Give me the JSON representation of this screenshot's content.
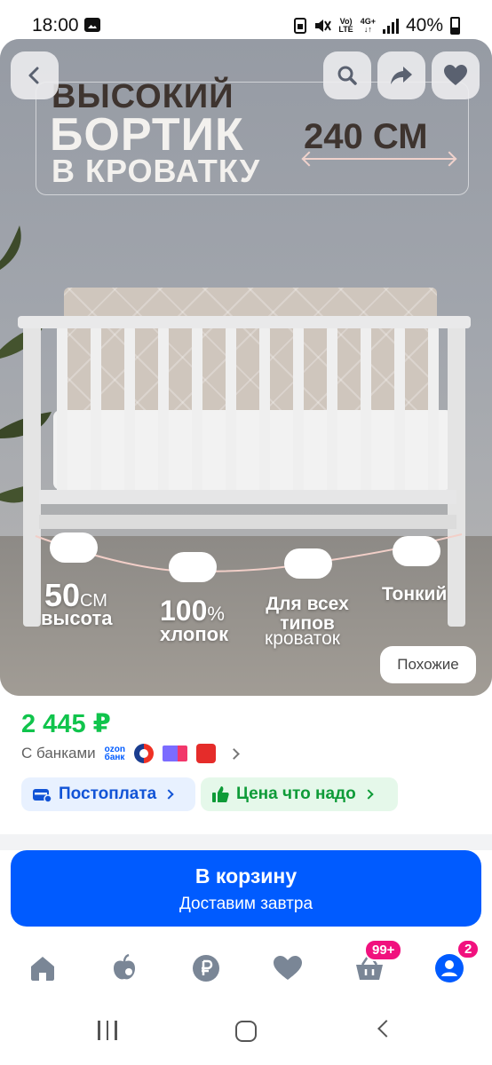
{
  "status_bar": {
    "time": "18:00",
    "net_top": "Vo)",
    "net_bottom": "LTE",
    "net2_top": "4G+",
    "net2_bottom": "↓↑",
    "battery": "40%"
  },
  "product_image": {
    "title_line1": "ВЫСОКИЙ",
    "title_line2": "БОРТИК",
    "title_line3": "В КРОВАТКУ",
    "size_label": "240 СМ",
    "features": {
      "height_value": "50",
      "height_unit": "СМ",
      "height_label": "высота",
      "cotton_value": "100",
      "cotton_unit": "%",
      "cotton_label": "хлопок",
      "all_types_line": "Для всех типов",
      "all_types_label": "кроваток",
      "thin_label": "Тонкий"
    },
    "similar_button": "Похожие"
  },
  "product": {
    "price": "2 445 ₽",
    "banks_label": "С банками",
    "ozon_bank_line1": "ozon",
    "ozon_bank_line2": "банк",
    "chip_postpay": "Постоплата",
    "chip_price": "Цена что надо"
  },
  "cart_button": {
    "label": "В корзину",
    "subtitle": "Доставим завтра"
  },
  "tabbar": {
    "cart_badge": "99+",
    "profile_badge": "2"
  },
  "colors": {
    "accent_blue": "#005bff",
    "price_green": "#10c44c",
    "badge_pink": "#f1117e",
    "icon_gray": "#7a8696"
  }
}
